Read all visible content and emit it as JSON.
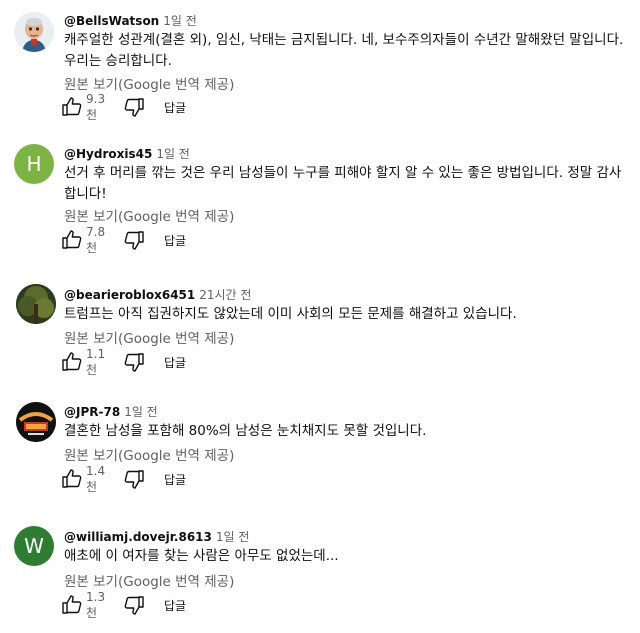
{
  "labels": {
    "translate": "원본 보기(Google 번역 제공)",
    "reply": "답글"
  },
  "comments": [
    {
      "author": "@BellsWatson",
      "time": "1일 전",
      "text": "캐주얼한 성관계(결혼 외), 임신, 낙태는 금지됩니다. 네, 보수주의자들이 수년간 말해왔던 말입니다. 우리는 승리합니다.",
      "likes": "9.3천",
      "avatar": {
        "type": "cartoon-man-icon",
        "initial": ""
      }
    },
    {
      "author": "@Hydroxis45",
      "time": "1일 전",
      "text": "선거 후 머리를 깎는 것은 우리 남성들이 누구를 피해야 할지 알 수 있는 좋은 방법입니다. 정말 감사합니다!",
      "likes": "7.8천",
      "avatar": {
        "type": "letter",
        "initial": "H",
        "color": "#7cb342"
      }
    },
    {
      "author": "@bearieroblox6451",
      "time": "21시간 전",
      "text": "트럼프는 아직 집권하지도 않았는데 이미 사회의 모든 문제를 해결하고 있습니다.",
      "likes": "1.1천",
      "avatar": {
        "type": "forest-photo-icon",
        "initial": ""
      }
    },
    {
      "author": "@JPR-78",
      "time": "1일 전",
      "text": "결혼한 남성을 포함해 80%의 남성은 눈치채지도 못할 것입니다.",
      "likes": "1.4천",
      "avatar": {
        "type": "retro-logo-icon",
        "initial": ""
      }
    },
    {
      "author": "@williamj.dovejr.8613",
      "time": "1일 전",
      "text": "애초에 이 여자를 찾는 사람은 아무도 없었는데...",
      "likes": "1.3천",
      "avatar": {
        "type": "letter",
        "initial": "W",
        "color": "#2e7d32"
      }
    }
  ]
}
